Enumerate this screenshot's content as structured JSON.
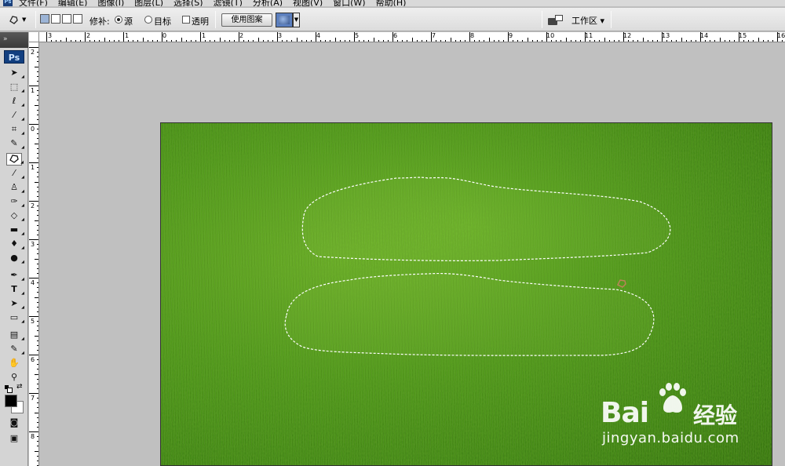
{
  "menubar": {
    "items": [
      "文件(F)",
      "编辑(E)",
      "图像(I)",
      "图层(L)",
      "选择(S)",
      "滤镜(T)",
      "分析(A)",
      "视图(V)",
      "窗口(W)",
      "帮助(H)"
    ]
  },
  "options": {
    "patch_label": "修补:",
    "source_label": "源",
    "destination_label": "目标",
    "transparent_label": "透明",
    "use_pattern_label": "使用图案",
    "workspace_label": "工作区 ▾",
    "patch_mode": "source"
  },
  "toolbox": {
    "grip": "»",
    "logo": "Ps",
    "icons": [
      "move-icon",
      "marquee-icon",
      "lasso-icon",
      "magic-wand-icon",
      "crop-icon",
      "eyedropper-icon",
      "patch-tool-icon",
      "brush-icon",
      "clone-stamp-icon",
      "history-brush-icon",
      "eraser-icon",
      "gradient-icon",
      "blur-icon",
      "dodge-icon",
      "pen-icon",
      "type-icon",
      "path-selection-icon",
      "rectangle-icon",
      "notes-icon",
      "eyedropper-2-icon",
      "hand-icon",
      "zoom-icon"
    ],
    "active_tool": "patch-tool-icon",
    "foreground_color": "#000000",
    "background_color": "#ffffff"
  },
  "ruler_top": {
    "labels": [
      "3",
      "2",
      "1",
      "0",
      "1",
      "2",
      "3",
      "4",
      "5",
      "6",
      "7",
      "8",
      "9",
      "10",
      "11",
      "12",
      "13",
      "14",
      "15",
      "16"
    ]
  },
  "ruler_left": {
    "labels": [
      "2",
      "1",
      "0",
      "1",
      "2",
      "3",
      "4",
      "5",
      "6",
      "7",
      "8"
    ]
  },
  "document": {
    "content": "grass photo with two lasso selections"
  },
  "watermark": {
    "brand": "Bai",
    "brand_cn": "经验",
    "url": "jingyan.baidu.com"
  }
}
